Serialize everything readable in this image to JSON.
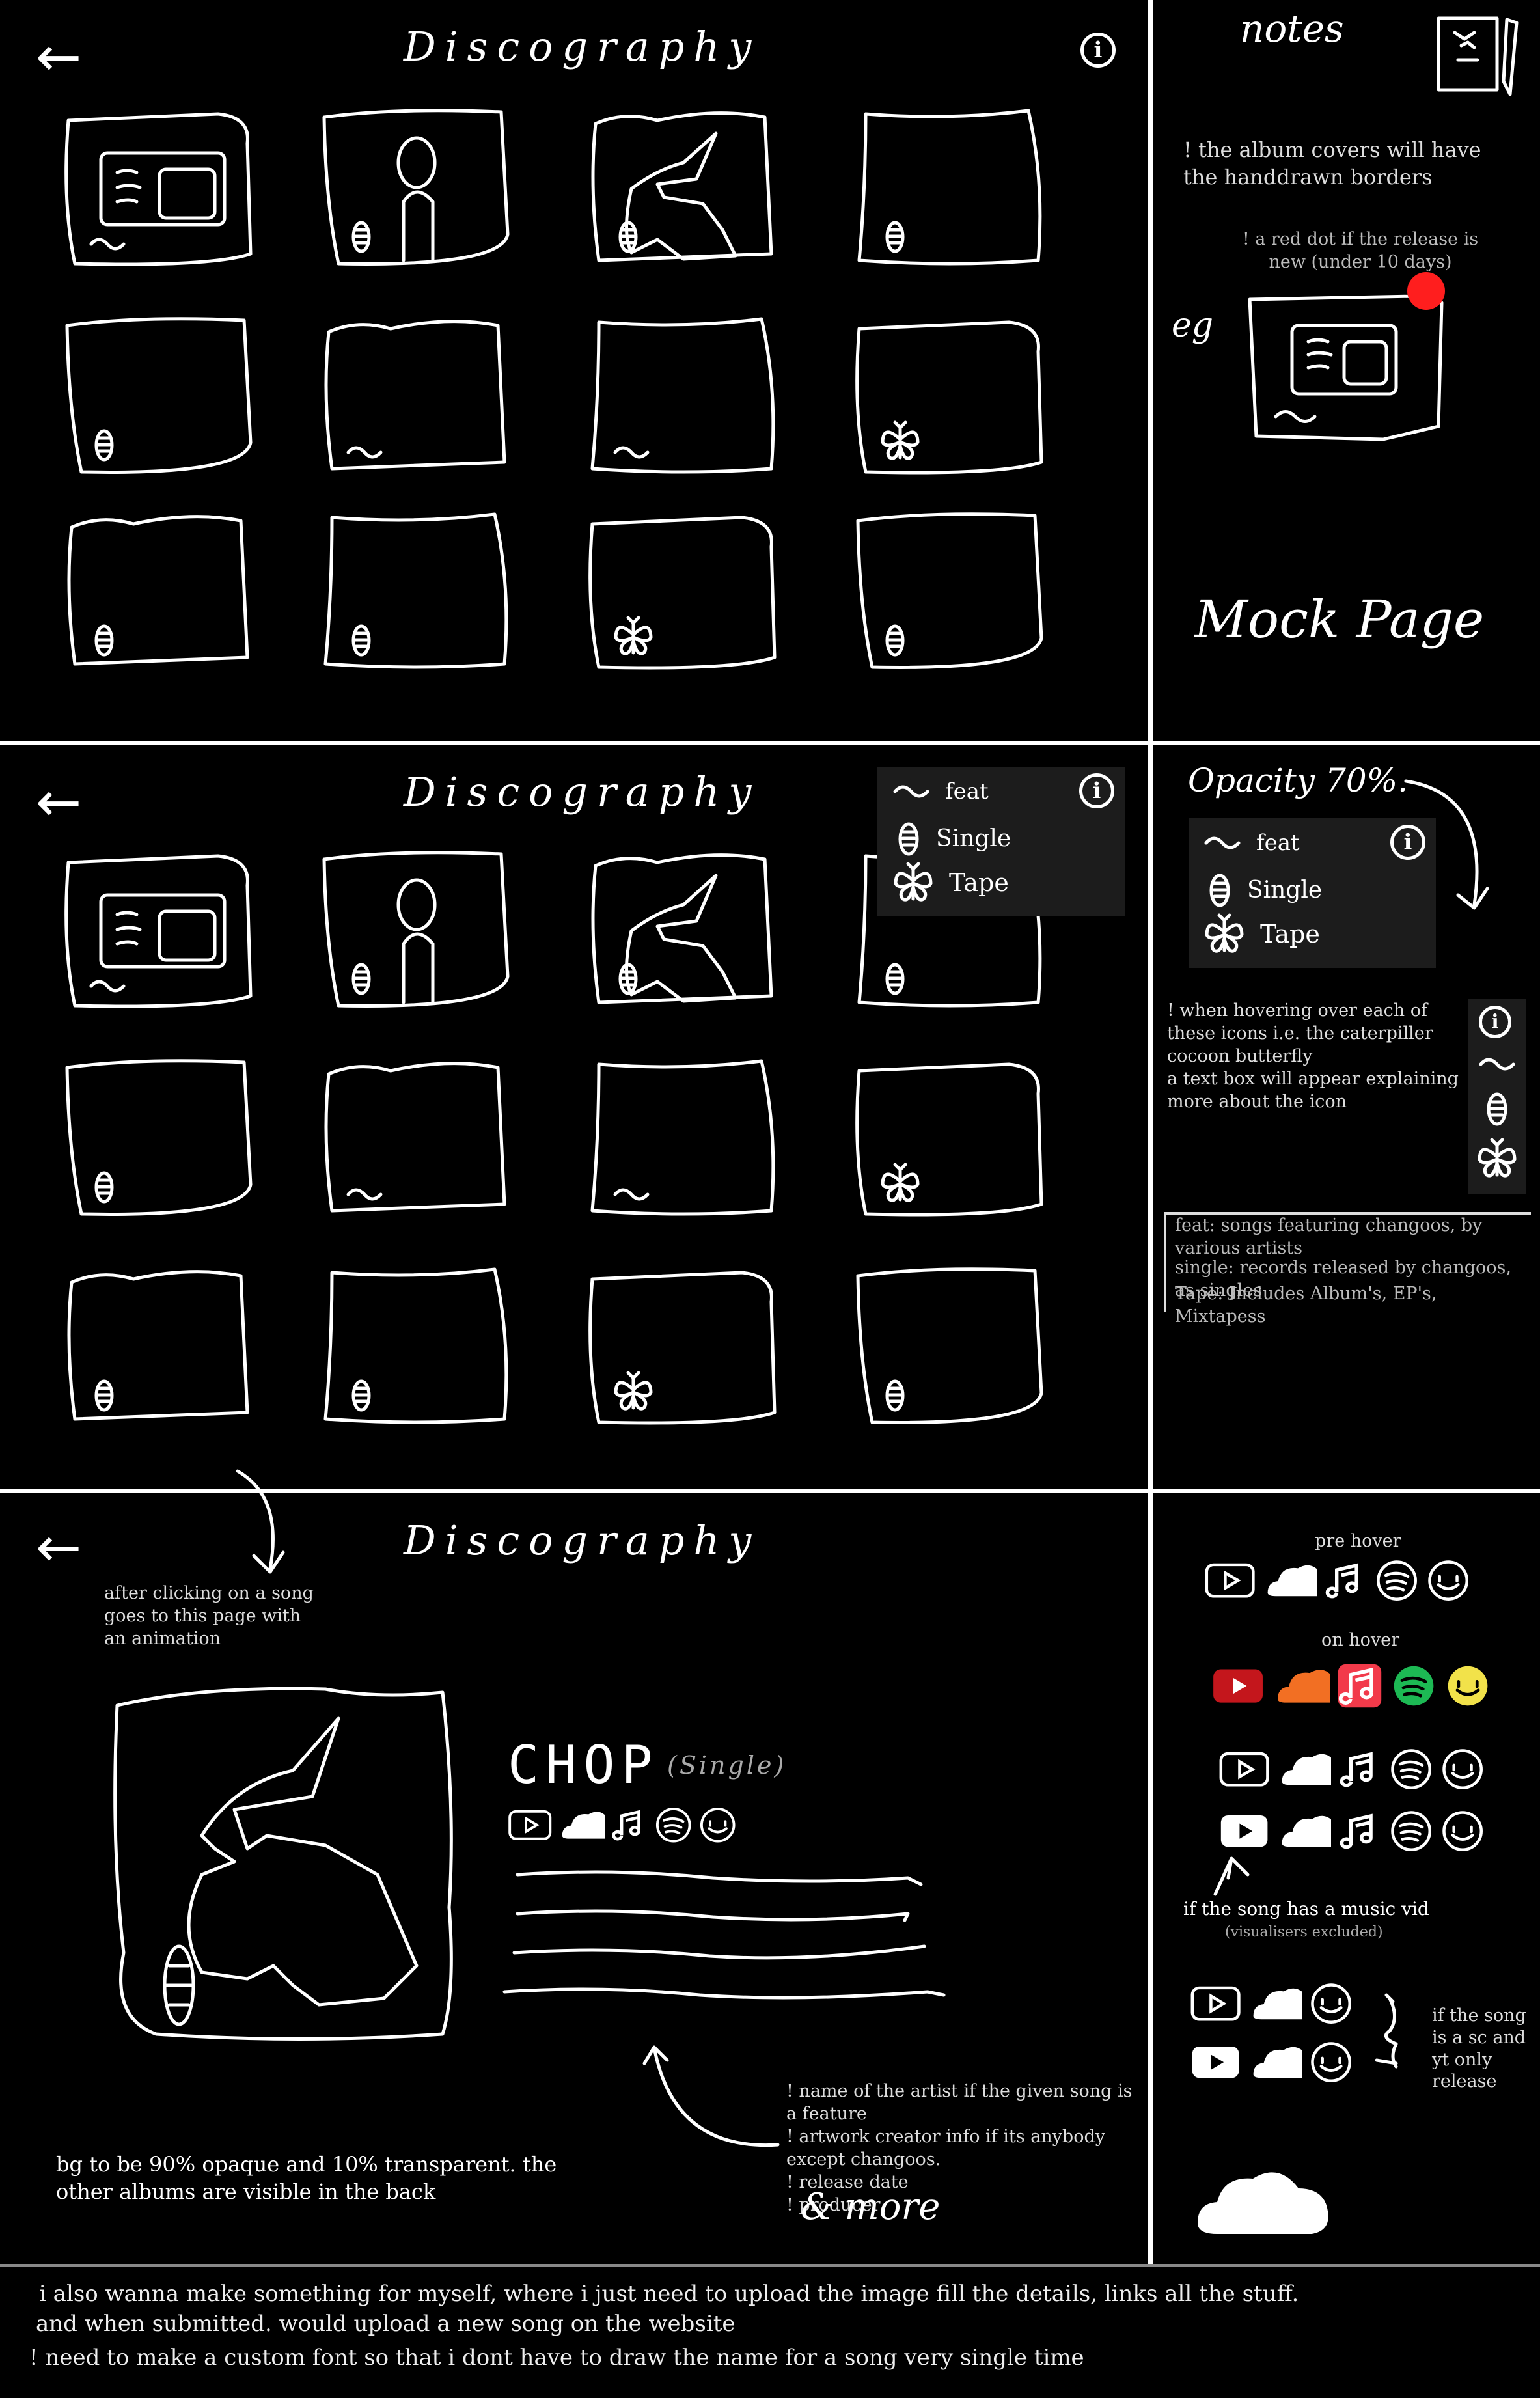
{
  "page_title": "Discography",
  "grid": [
    {
      "row": 0,
      "items": [
        {
          "art": "text",
          "badge": "feat"
        },
        {
          "art": "person",
          "badge": "single"
        },
        {
          "art": "bird",
          "badge": "single"
        },
        {
          "art": "empty",
          "badge": "single"
        }
      ]
    },
    {
      "row": 1,
      "items": [
        {
          "art": "empty",
          "badge": "single"
        },
        {
          "art": "empty",
          "badge": "feat"
        },
        {
          "art": "empty",
          "badge": "feat"
        },
        {
          "art": "empty",
          "badge": "tape"
        }
      ]
    },
    {
      "row": 2,
      "items": [
        {
          "art": "empty",
          "badge": "single"
        },
        {
          "art": "empty",
          "badge": "single"
        },
        {
          "art": "empty",
          "badge": "tape"
        },
        {
          "art": "empty",
          "badge": "single"
        }
      ]
    }
  ],
  "legend": {
    "feat": "feat",
    "single": "Single",
    "tape": "Tape"
  },
  "notes": {
    "header": "notes",
    "border_note": "! the album covers will have the handdrawn borders",
    "red_dot_note": "! a red dot if the release is new (under 10 days)",
    "eg": "eg",
    "mock_page": "Mock Page",
    "opacity": "Opacity 70%.",
    "hover_note": "! when hovering over each of these icons i.e. the caterpiller cocoon butterfly\na text box will appear explaining more about the icon",
    "feat_def": "feat: songs featuring changoos, by various artists",
    "single_def": "single: records released by changoos, as singles",
    "tape_def": "Tape: Includes Album's, EP's, Mixtapess",
    "after_click": "after clicking on a song goes to this page with an animation",
    "pre_hover": "pre hover",
    "on_hover": "on hover",
    "music_vid": "if the song has a music vid",
    "visualisers": "(visualisers excluded)",
    "sc_yt": "if the song is a sc and yt only release",
    "artist_notes": "! name of the artist if the given song is a feature\n! artwork creator info if its anybody except changoos.\n! release date\n! producer",
    "and_more": "& more",
    "bg_note": "bg to be 90% opaque and 10% transparent. the other albums are visible in the back",
    "footer1": "i also wanna make something for myself, where i just need to upload the image fill the details, links all the stuff.",
    "footer2": " and when submitted. would upload a new song on the website",
    "footer3": "! need to make a custom font so that i dont have to draw the name for a song very single time"
  },
  "detail": {
    "song_title": "CHOP",
    "song_type": "(Single)"
  },
  "colors": {
    "youtube": "#c4161c",
    "soundcloud": "#f26f23",
    "apple_music": "#f23a4a",
    "spotify": "#1db954",
    "audiomack": "#f2e24a",
    "red_dot": "#ff1e1e"
  }
}
